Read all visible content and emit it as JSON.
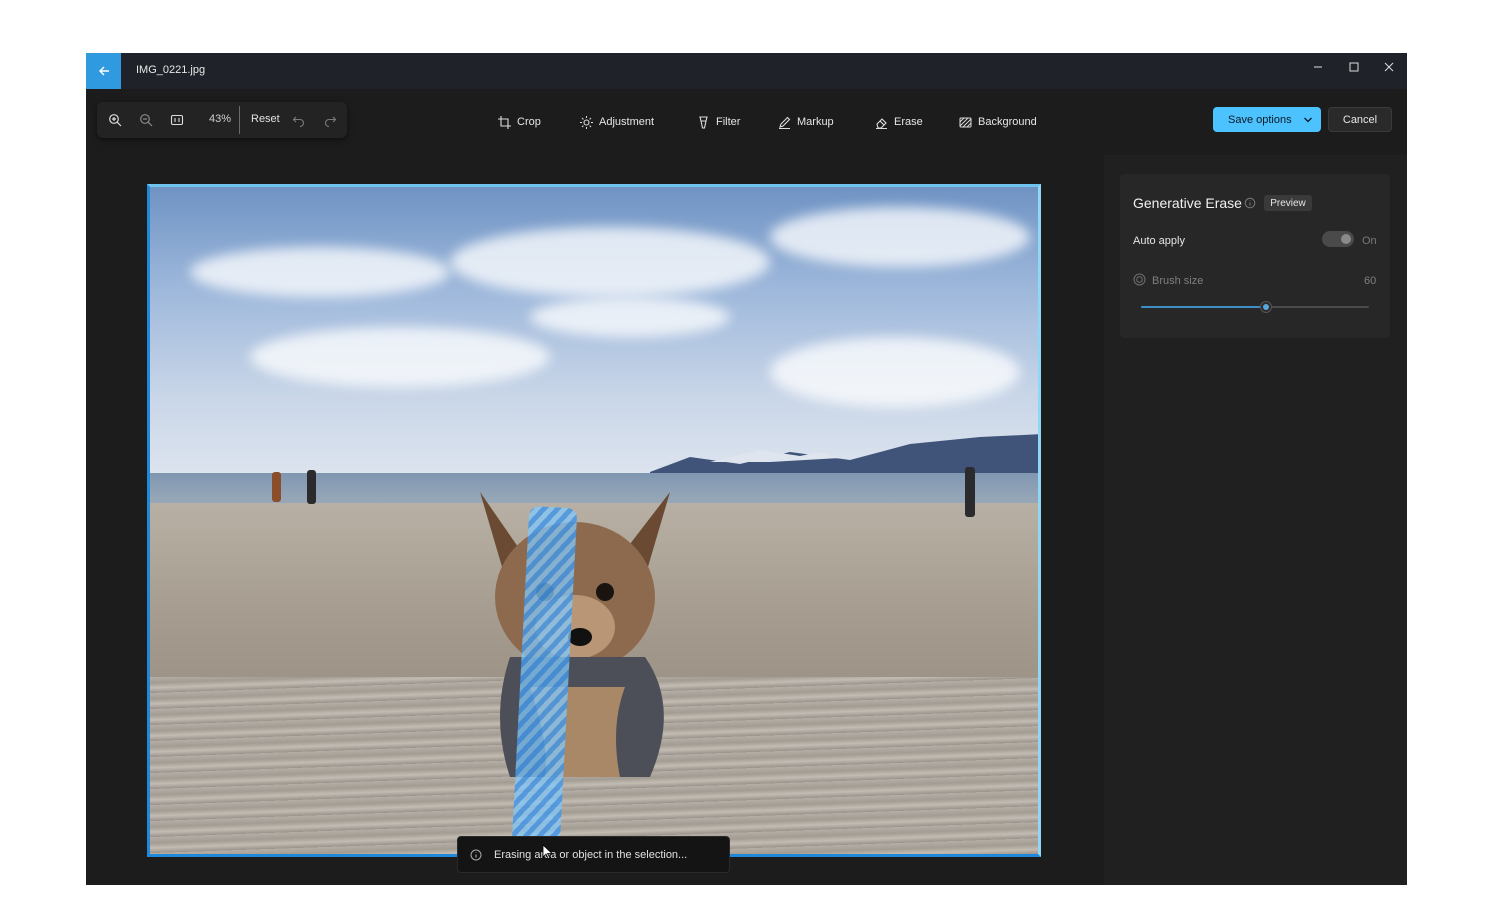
{
  "window": {
    "file_name": "IMG_0221.jpg"
  },
  "toolbar": {
    "zoom_level": "43%",
    "reset_label": "Reset",
    "tools": [
      {
        "label": "Crop",
        "icon": "crop-icon"
      },
      {
        "label": "Adjustment",
        "icon": "brightness-icon"
      },
      {
        "label": "Filter",
        "icon": "filter-icon"
      },
      {
        "label": "Markup",
        "icon": "pen-icon"
      },
      {
        "label": "Erase",
        "icon": "eraser-icon",
        "active": true
      },
      {
        "label": "Background",
        "icon": "background-icon"
      }
    ],
    "save_label": "Save options",
    "cancel_label": "Cancel"
  },
  "canvas": {
    "status_message": "Erasing area or object in the selection..."
  },
  "panel": {
    "title": "Generative Erase",
    "badge": "Preview",
    "auto_apply_label": "Auto apply",
    "auto_apply_state": "On",
    "brush_size_label": "Brush size",
    "brush_size_value": "60",
    "brush_size_fraction": 0.55
  },
  "colors": {
    "accent": "#4cc2ff",
    "back_button": "#2f9ae0"
  }
}
